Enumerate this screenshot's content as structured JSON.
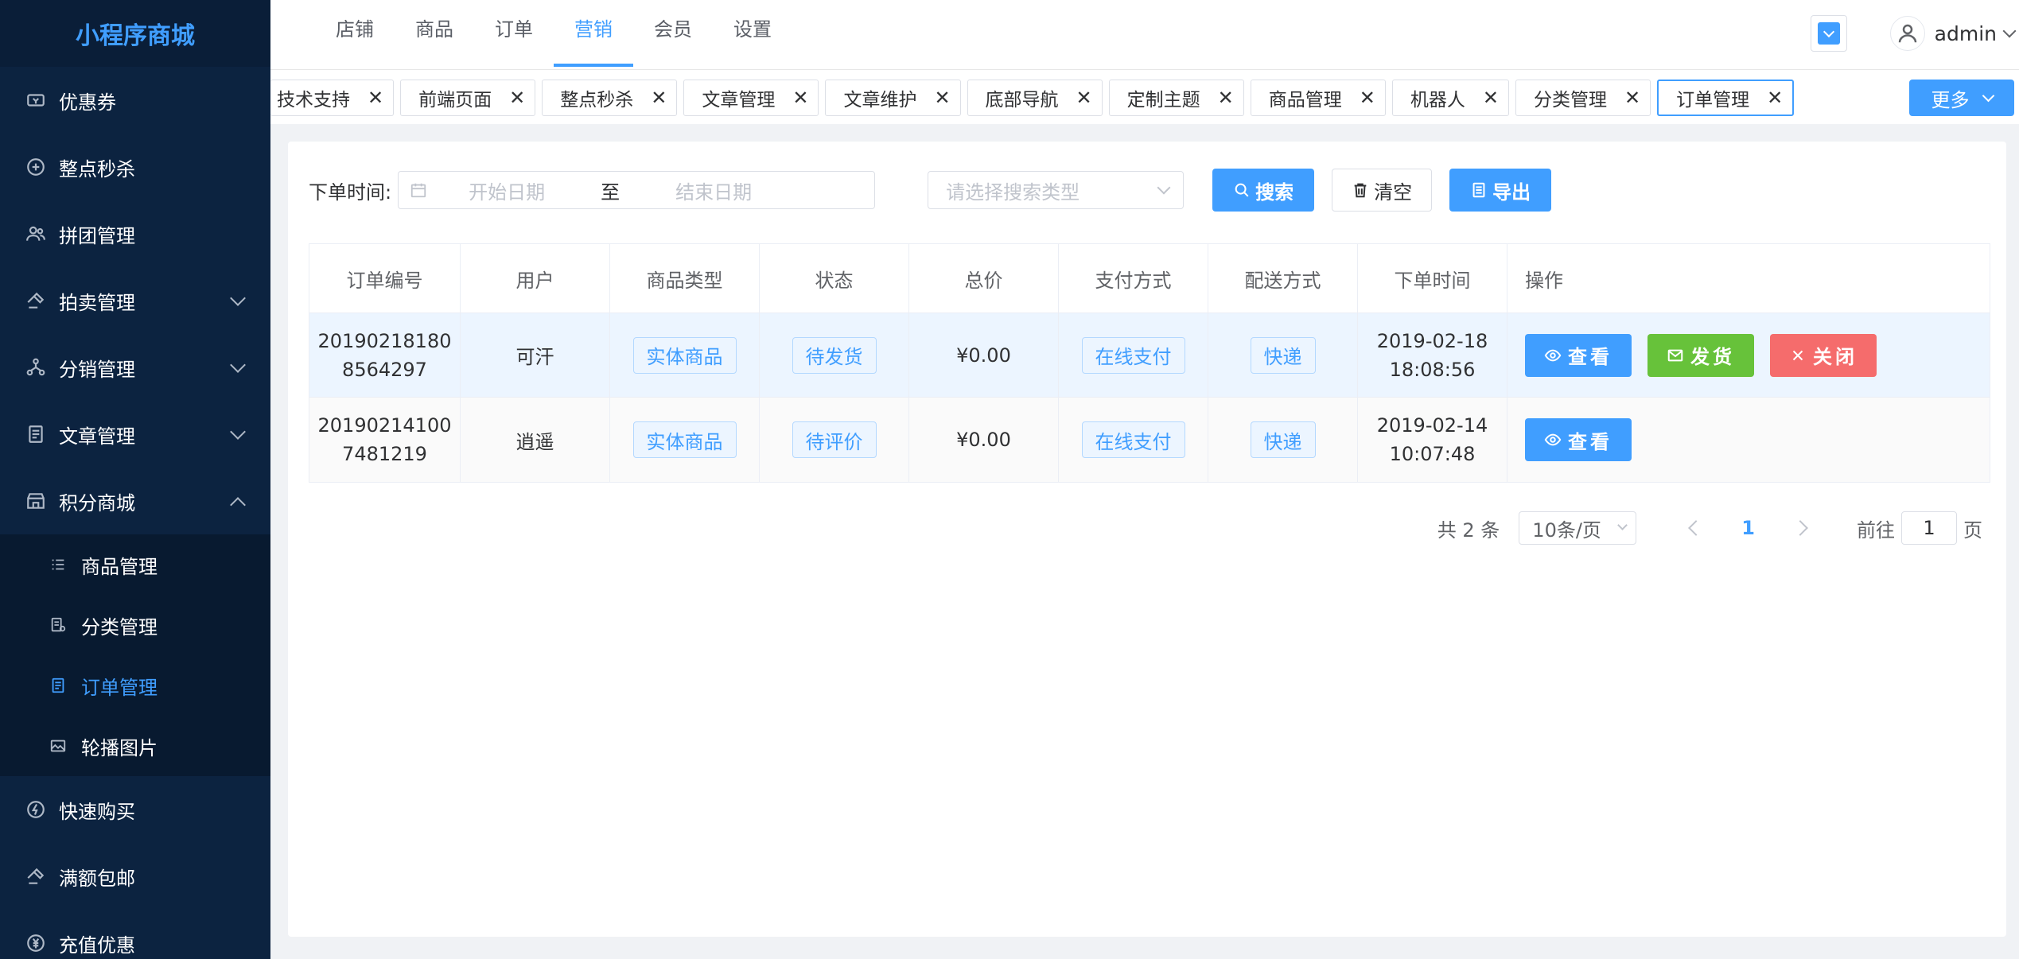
{
  "app": {
    "brand": "小程序商城"
  },
  "sidebar": {
    "items": [
      {
        "label": "优惠券",
        "icon": "coupon-icon"
      },
      {
        "label": "整点秒杀",
        "icon": "flash-sale-icon"
      },
      {
        "label": "拼团管理",
        "icon": "group-icon"
      },
      {
        "label": "拍卖管理",
        "icon": "auction-icon"
      },
      {
        "label": "分销管理",
        "icon": "distribution-icon"
      },
      {
        "label": "文章管理",
        "icon": "article-icon"
      },
      {
        "label": "积分商城",
        "icon": "points-mall-icon"
      },
      {
        "label": "快速购买",
        "icon": "quick-buy-icon"
      },
      {
        "label": "满额包邮",
        "icon": "free-shipping-icon"
      },
      {
        "label": "充值优惠",
        "icon": "recharge-icon"
      }
    ],
    "submenu": [
      {
        "label": "商品管理",
        "icon": "list-icon"
      },
      {
        "label": "分类管理",
        "icon": "category-icon"
      },
      {
        "label": "订单管理",
        "icon": "order-icon"
      },
      {
        "label": "轮播图片",
        "icon": "image-icon"
      }
    ]
  },
  "header": {
    "nav": [
      "店铺",
      "商品",
      "订单",
      "营销",
      "会员",
      "设置"
    ],
    "active_nav": "营销",
    "username": "admin"
  },
  "tags": {
    "items": [
      "技术支持",
      "前端页面",
      "整点秒杀",
      "文章管理",
      "文章维护",
      "底部导航",
      "定制主题",
      "商品管理",
      "机器人",
      "分类管理",
      "订单管理"
    ],
    "close_glyph": "✕",
    "more_label": "更多"
  },
  "search": {
    "label": "下单时间:",
    "start_placeholder": "开始日期",
    "separator": "至",
    "end_placeholder": "结束日期",
    "type_placeholder": "请选择搜索类型",
    "search_label": "搜索",
    "clear_label": "清空",
    "export_label": "导出"
  },
  "table": {
    "columns": [
      "订单编号",
      "用户",
      "商品类型",
      "状态",
      "总价",
      "支付方式",
      "配送方式",
      "下单时间",
      "操作"
    ],
    "rows": [
      {
        "order_no": "201902181808564297",
        "user": "可汗",
        "goods_type": "实体商品",
        "status": "待发货",
        "total": "¥0.00",
        "payment": "在线支付",
        "delivery": "快递",
        "time": "2019-02-18 18:08:56",
        "view": "查看",
        "ship": "发货",
        "close": "关闭"
      },
      {
        "order_no": "201902141007481219",
        "user": "逍遥",
        "goods_type": "实体商品",
        "status": "待评价",
        "total": "¥0.00",
        "payment": "在线支付",
        "delivery": "快递",
        "time": "2019-02-14 10:07:48",
        "view": "查看"
      }
    ]
  },
  "pager": {
    "total": "共 2 条",
    "page_size": "10条/页",
    "current": "1",
    "goto_prefix": "前往",
    "goto_value": "1",
    "goto_suffix": "页"
  },
  "colors": {
    "primary": "#409eff",
    "success": "#67c23a",
    "danger": "#f56c6c",
    "sidebar_bg": "#0c2340"
  }
}
